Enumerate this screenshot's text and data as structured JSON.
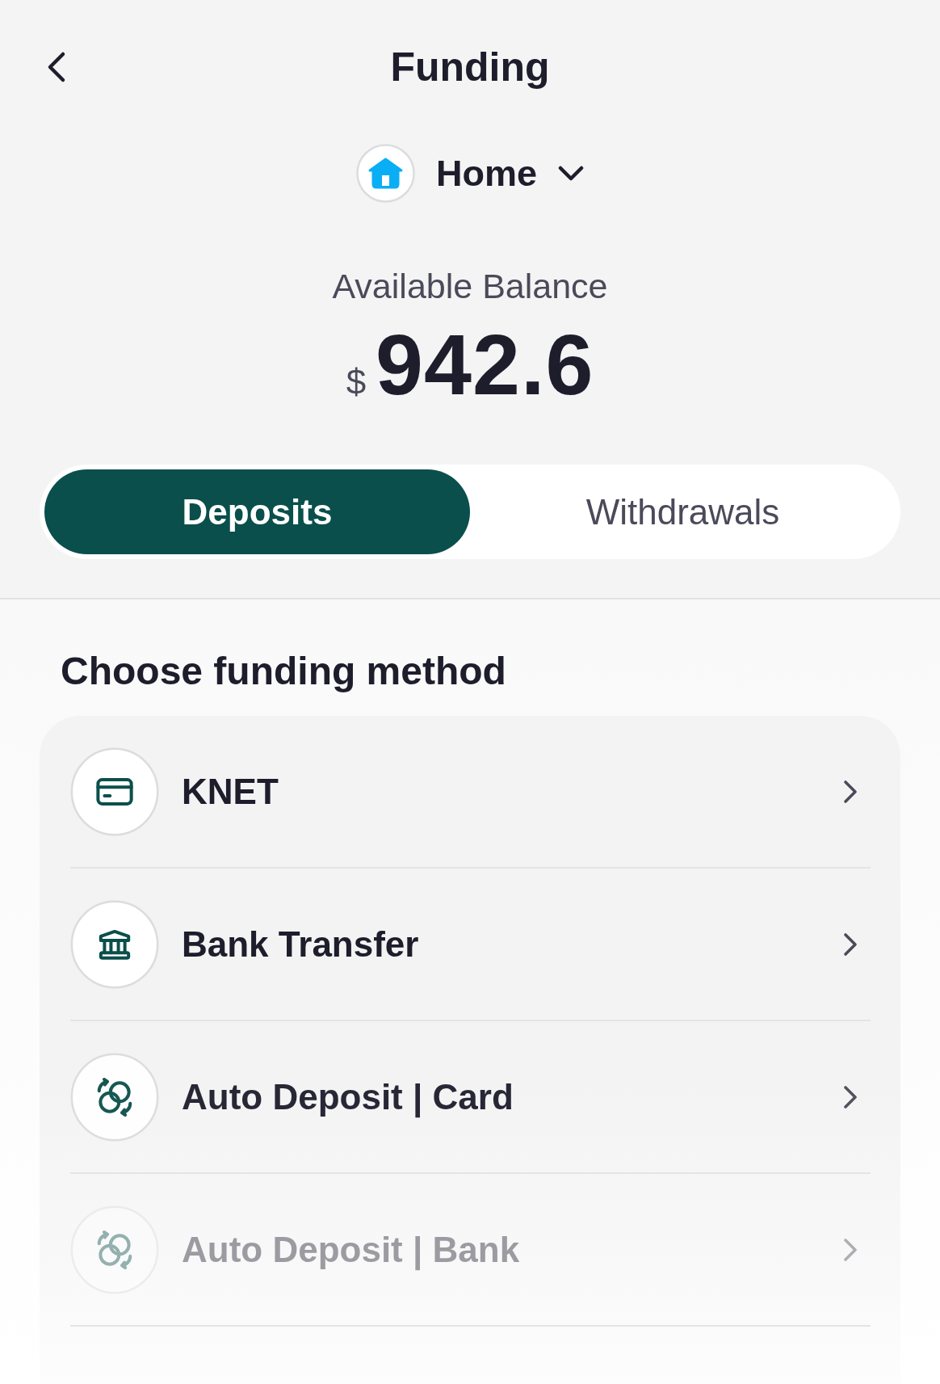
{
  "header": {
    "title": "Funding"
  },
  "account": {
    "name": "Home"
  },
  "balance": {
    "label": "Available Balance",
    "currency": "$",
    "amount": "942.6"
  },
  "tabs": [
    {
      "label": "Deposits",
      "selected": true
    },
    {
      "label": "Withdrawals",
      "selected": false
    }
  ],
  "methods": {
    "title": "Choose funding method",
    "items": [
      {
        "kind": "card",
        "label": "KNET"
      },
      {
        "kind": "bank",
        "label": "Bank Transfer"
      },
      {
        "kind": "auto",
        "label": "Auto Deposit | Card"
      },
      {
        "kind": "auto",
        "label": "Auto Deposit | Bank"
      }
    ]
  }
}
